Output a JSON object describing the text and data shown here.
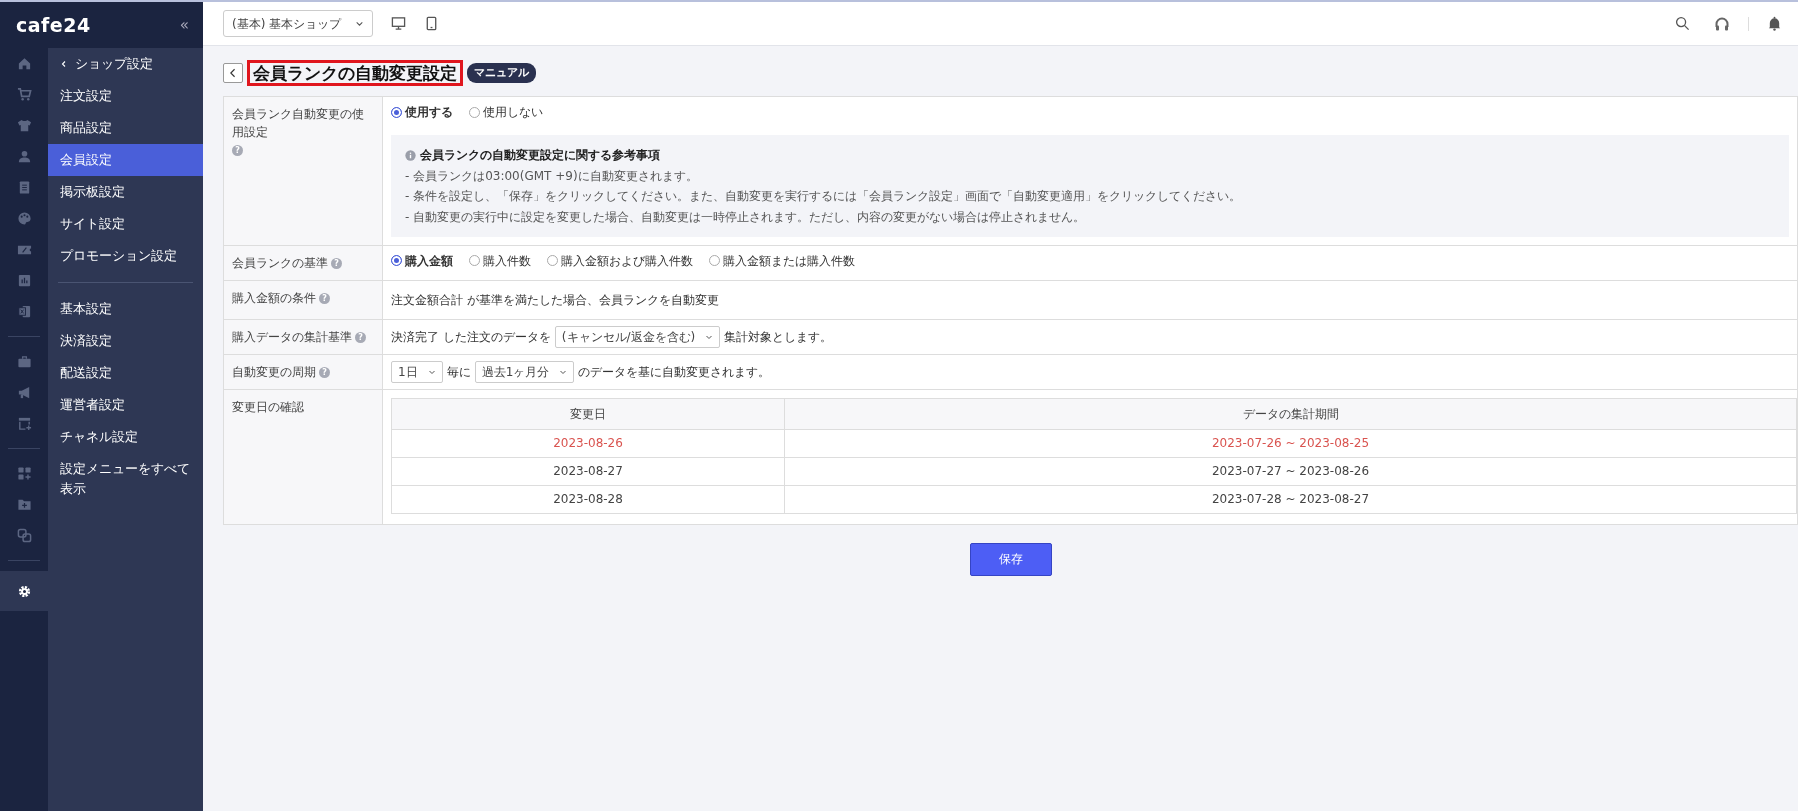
{
  "brand": {
    "logo": "cafe24",
    "collapse": "«"
  },
  "rail": [
    {
      "kind": "home",
      "selected": false
    },
    {
      "kind": "cart",
      "selected": false
    },
    {
      "kind": "shirt",
      "selected": false
    },
    {
      "kind": "person",
      "selected": false
    },
    {
      "kind": "document",
      "selected": false
    },
    {
      "kind": "palette",
      "selected": false
    },
    {
      "kind": "ticket",
      "selected": false
    },
    {
      "kind": "chart",
      "selected": false
    },
    {
      "kind": "sheet",
      "selected": false
    },
    {
      "kind": "divider"
    },
    {
      "kind": "briefcase",
      "selected": false
    },
    {
      "kind": "megaphone",
      "selected": false
    },
    {
      "kind": "store",
      "selected": false
    },
    {
      "kind": "divider"
    },
    {
      "kind": "apps",
      "selected": false
    },
    {
      "kind": "folder",
      "selected": false
    },
    {
      "kind": "link",
      "selected": false
    },
    {
      "kind": "divider"
    },
    {
      "kind": "gear",
      "selected": true
    }
  ],
  "submenu": {
    "back": "ショップ設定",
    "groups": [
      [
        {
          "label": "注文設定",
          "selected": false
        },
        {
          "label": "商品設定",
          "selected": false
        },
        {
          "label": "会員設定",
          "selected": true
        },
        {
          "label": "掲示板設定",
          "selected": false
        },
        {
          "label": "サイト設定",
          "selected": false
        },
        {
          "label": "プロモーション設定",
          "selected": false
        }
      ],
      [
        {
          "label": "基本設定",
          "selected": false
        },
        {
          "label": "決済設定",
          "selected": false
        },
        {
          "label": "配送設定",
          "selected": false
        },
        {
          "label": "運営者設定",
          "selected": false
        },
        {
          "label": "チャネル設定",
          "selected": false
        },
        {
          "label": "設定メニューをすべて表示",
          "selected": false
        }
      ]
    ]
  },
  "topbar": {
    "shop_select": "(基本) 基本ショップ"
  },
  "page": {
    "title": "会員ランクの自動変更設定",
    "title_highlighted": true,
    "manual_badge": "マニュアル"
  },
  "form": [
    {
      "kind": "radios",
      "label": "会員ランク自動変更の使用設定",
      "help": "?",
      "options": [
        {
          "label": "使用する",
          "selected": true
        },
        {
          "label": "使用しない",
          "selected": false
        }
      ],
      "note": {
        "title": "会員ランクの自動変更設定に関する参考事項",
        "lines": [
          "- 会員ランクは03:00(GMT +9)に自動変更されます。",
          "- 条件を設定し、「保存」をクリックしてください。また、自動変更を実行するには「会員ランク設定」画面で「自動変更適用」をクリックしてください。",
          "- 自動変更の実行中に設定を変更した場合、自動変更は一時停止されます。ただし、内容の変更がない場合は停止されません。"
        ]
      }
    },
    {
      "kind": "radios",
      "label": "会員ランクの基準",
      "help": "?",
      "options": [
        {
          "label": "購入金額",
          "selected": true
        },
        {
          "label": "購入件数",
          "selected": false
        },
        {
          "label": "購入金額および購入件数",
          "selected": false
        },
        {
          "label": "購入金額または購入件数",
          "selected": false
        }
      ]
    },
    {
      "kind": "text",
      "label": "購入金額の条件",
      "help": "?",
      "text": "注文金額合計 が基準を満たした場合、会員ランクを自動変更"
    },
    {
      "kind": "inline",
      "label": "購入データの集計基準",
      "help": "?",
      "parts": [
        {
          "kind": "text",
          "text": "決済完了 した注文のデータを"
        },
        {
          "kind": "select",
          "value": "(キャンセル/返金を含む)"
        },
        {
          "kind": "text",
          "text": "集計対象とします。"
        }
      ]
    },
    {
      "kind": "inline",
      "label": "自動変更の周期",
      "help": "?",
      "parts": [
        {
          "kind": "select",
          "value": "1日"
        },
        {
          "kind": "text",
          "text": "毎に"
        },
        {
          "kind": "select",
          "value": "過去1ヶ月分"
        },
        {
          "kind": "text",
          "text": "のデータを基に自動変更されます。"
        }
      ]
    },
    {
      "kind": "table",
      "label": "変更日の確認",
      "columns": [
        "変更日",
        "データの集計期間"
      ],
      "rows": [
        {
          "cells": [
            "2023-08-26",
            "2023-07-26 ~ 2023-08-25"
          ],
          "current": true
        },
        {
          "cells": [
            "2023-08-27",
            "2023-07-27 ~ 2023-08-26"
          ],
          "current": false
        },
        {
          "cells": [
            "2023-08-28",
            "2023-07-28 ~ 2023-08-27"
          ],
          "current": false
        }
      ]
    }
  ],
  "save_button": "保存"
}
